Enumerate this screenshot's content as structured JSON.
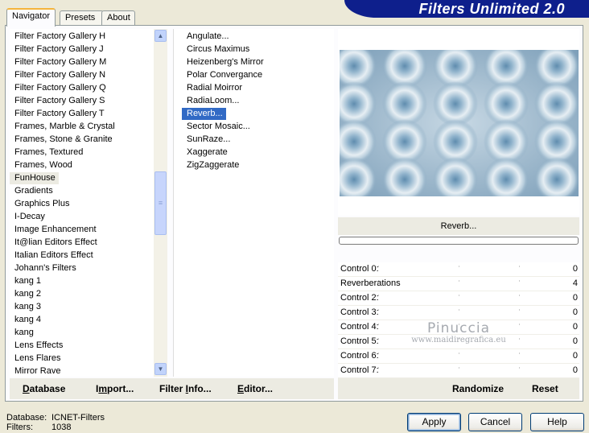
{
  "banner": {
    "title": "Filters Unlimited 2.0"
  },
  "tabs": [
    {
      "label": "Navigator",
      "active": true
    },
    {
      "label": "Presets",
      "active": false
    },
    {
      "label": "About",
      "active": false
    }
  ],
  "categories": [
    "Filter Factory Gallery H",
    "Filter Factory Gallery J",
    "Filter Factory Gallery M",
    "Filter Factory Gallery N",
    "Filter Factory Gallery Q",
    "Filter Factory Gallery S",
    "Filter Factory Gallery T",
    "Frames, Marble & Crystal",
    "Frames, Stone & Granite",
    "Frames, Textured",
    "Frames, Wood",
    "FunHouse",
    "Gradients",
    "Graphics Plus",
    "I-Decay",
    "Image Enhancement",
    "It@lian Editors Effect",
    "Italian Editors Effect",
    "Johann's Filters",
    "kang 1",
    "kang 2",
    "kang 3",
    "kang 4",
    "kang",
    "Lens Effects",
    "Lens Flares",
    "Mirror Rave"
  ],
  "selected_category": "FunHouse",
  "filters": [
    "Angulate...",
    "Circus Maximus",
    "Heizenberg's Mirror",
    "Polar Convergance",
    "Radial Moirror",
    "RadiaLoom...",
    "Reverb...",
    "Sector Mosaic...",
    "SunRaze...",
    "Xaggerate",
    "ZigZaggerate"
  ],
  "selected_filter": "Reverb...",
  "preview": {
    "filter_name": "Reverb...",
    "progress": 0
  },
  "controls": [
    {
      "label": "Control 0:",
      "value": "0"
    },
    {
      "label": "Reverberations",
      "value": "4"
    },
    {
      "label": "Control 2:",
      "value": "0"
    },
    {
      "label": "Control 3:",
      "value": "0"
    },
    {
      "label": "Control 4:",
      "value": "0"
    },
    {
      "label": "Control 5:",
      "value": "0"
    },
    {
      "label": "Control 6:",
      "value": "0"
    },
    {
      "label": "Control 7:",
      "value": "0"
    }
  ],
  "watermark": {
    "line1": "Pinuccia",
    "line2": "www.maidiregrafica.eu"
  },
  "left_buttons": {
    "database": {
      "u": "D",
      "rest": "atabase"
    },
    "import": {
      "pre": "I",
      "u": "m",
      "rest": "port..."
    },
    "filter_info": {
      "pre": "Filter ",
      "u": "I",
      "rest": "nfo..."
    },
    "editor": {
      "u": "E",
      "rest": "ditor..."
    }
  },
  "right_buttons": {
    "randomize": "Randomize",
    "reset": "Reset"
  },
  "status": {
    "database_label": "Database:",
    "database_value": "ICNET-Filters",
    "filters_label": "Filters:",
    "filters_value": "1038"
  },
  "dialog_buttons": {
    "apply": "Apply",
    "cancel": "Cancel",
    "help": "Help"
  },
  "colors": {
    "banner": "#0e1f8c",
    "selection": "#316ac5",
    "tab_highlight": "#f5b43c"
  }
}
